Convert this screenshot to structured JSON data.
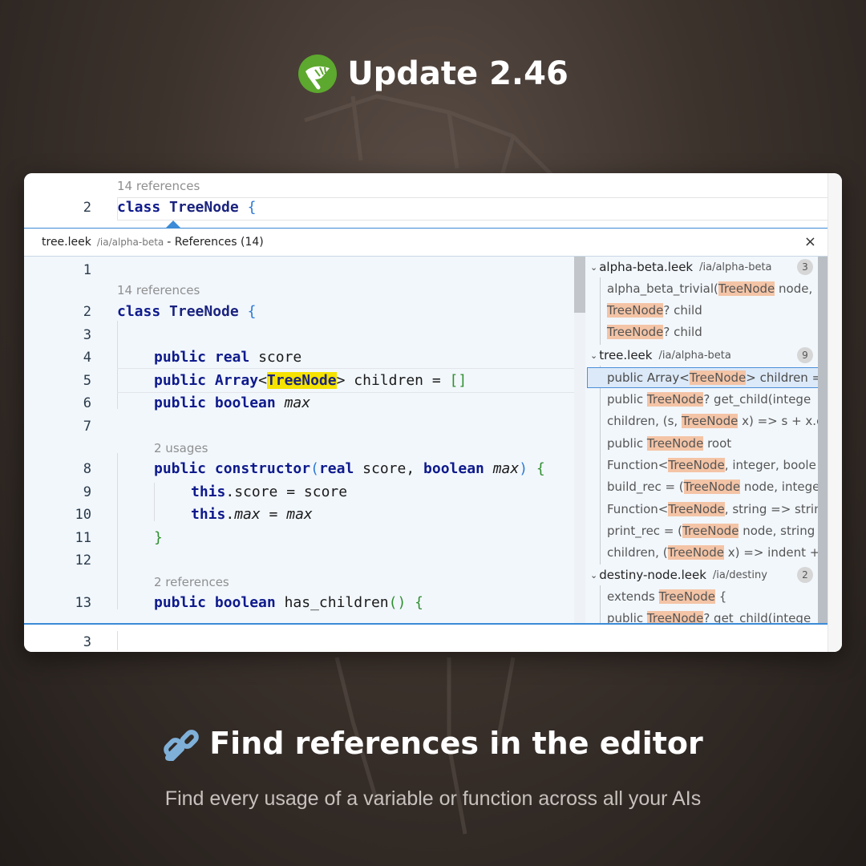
{
  "header": {
    "title": "Update 2.46",
    "logo_icon": "leek-logo-icon"
  },
  "editor_top": {
    "hint": "14 references",
    "line_number": "2",
    "code": {
      "keyword": "class",
      "name": "TreeNode",
      "brace": "{"
    }
  },
  "references_panel": {
    "file": "tree.leek",
    "path": "/ia/alpha-beta",
    "title": "- References (14)",
    "close_label": "×"
  },
  "code_lines": {
    "l1": "1",
    "hint1": "14 references",
    "l2": "2",
    "l2_kw": "class",
    "l2_name": "TreeNode",
    "l2_brace": "{",
    "l3": "3",
    "l4": "4",
    "l4_kw1": "public",
    "l4_kw2": "real",
    "l4_rest": "score",
    "l5": "5",
    "l5_kw1": "public",
    "l5_kw2": "Array",
    "l5_lt": "<",
    "l5_match": "TreeNode",
    "l5_gt": ">",
    "l5_rest": "children = ",
    "l5_arr": "[]",
    "l6": "6",
    "l6_kw1": "public",
    "l6_kw2": "boolean",
    "l6_rest": "max",
    "l7": "7",
    "hint2": "2 usages",
    "l8": "8",
    "l8_kw1": "public",
    "l8_kw2": "constructor",
    "l8_open": "(",
    "l8_t1": "real",
    "l8_p1": "score,",
    "l8_t2": "boolean",
    "l8_p2": "max",
    "l8_close": ")",
    "l8_brace": "{",
    "l9": "9",
    "l9_kw": "this",
    "l9_rest": ".score = score",
    "l10": "10",
    "l10_kw": "this",
    "l10_dot": ".",
    "l10_a": "max",
    "l10_eq": " = ",
    "l10_b": "max",
    "l11": "11",
    "l11_brace": "}",
    "l12": "12",
    "hint3": "2 references",
    "l13": "13",
    "l13_kw1": "public",
    "l13_kw2": "boolean",
    "l13_name": "has_children",
    "l13_paren": "()",
    "l13_brace": "{"
  },
  "reference_tree": {
    "groups": [
      {
        "file": "alpha-beta.leek",
        "path": "/ia/alpha-beta",
        "count": "3",
        "items": [
          {
            "pre": "alpha_beta_trivial(",
            "match": "TreeNode",
            "post": " node,"
          },
          {
            "pre": "",
            "match": "TreeNode",
            "post": "? child"
          },
          {
            "pre": "",
            "match": "TreeNode",
            "post": "? child"
          }
        ]
      },
      {
        "file": "tree.leek",
        "path": "/ia/alpha-beta",
        "count": "9",
        "items": [
          {
            "pre": "public Array<",
            "match": "TreeNode",
            "post": "> children ="
          },
          {
            "pre": "public ",
            "match": "TreeNode",
            "post": "? get_child(intege"
          },
          {
            "pre": "children, (s, ",
            "match": "TreeNode",
            "post": " x) => s + x.co"
          },
          {
            "pre": "public ",
            "match": "TreeNode",
            "post": " root"
          },
          {
            "pre": "Function<",
            "match": "TreeNode",
            "post": ", integer, boole"
          },
          {
            "pre": "build_rec = (",
            "match": "TreeNode",
            "post": " node, intege"
          },
          {
            "pre": "Function<",
            "match": "TreeNode",
            "post": ", string => strin"
          },
          {
            "pre": "print_rec = (",
            "match": "TreeNode",
            "post": " node, string"
          },
          {
            "pre": "children, (",
            "match": "TreeNode",
            "post": " x) => indent +"
          }
        ]
      },
      {
        "file": "destiny-node.leek",
        "path": "/ia/destiny",
        "count": "2",
        "items": [
          {
            "pre": "extends ",
            "match": "TreeNode",
            "post": " {"
          },
          {
            "pre": "public ",
            "match": "TreeNode",
            "post": "? get_child(intege"
          }
        ]
      }
    ]
  },
  "editor_bottom": {
    "line_number": "3"
  },
  "footer": {
    "icon": "link-icon",
    "title": "Find references in the editor",
    "subtitle": "Find every usage of a variable or function across all your AIs"
  },
  "colors": {
    "keyword": "#0e1a8c",
    "match_highlight": "#f4c4a6",
    "current_match": "#f6e200",
    "accent_blue": "#3b8bd6",
    "logo_green": "#5da82e"
  }
}
